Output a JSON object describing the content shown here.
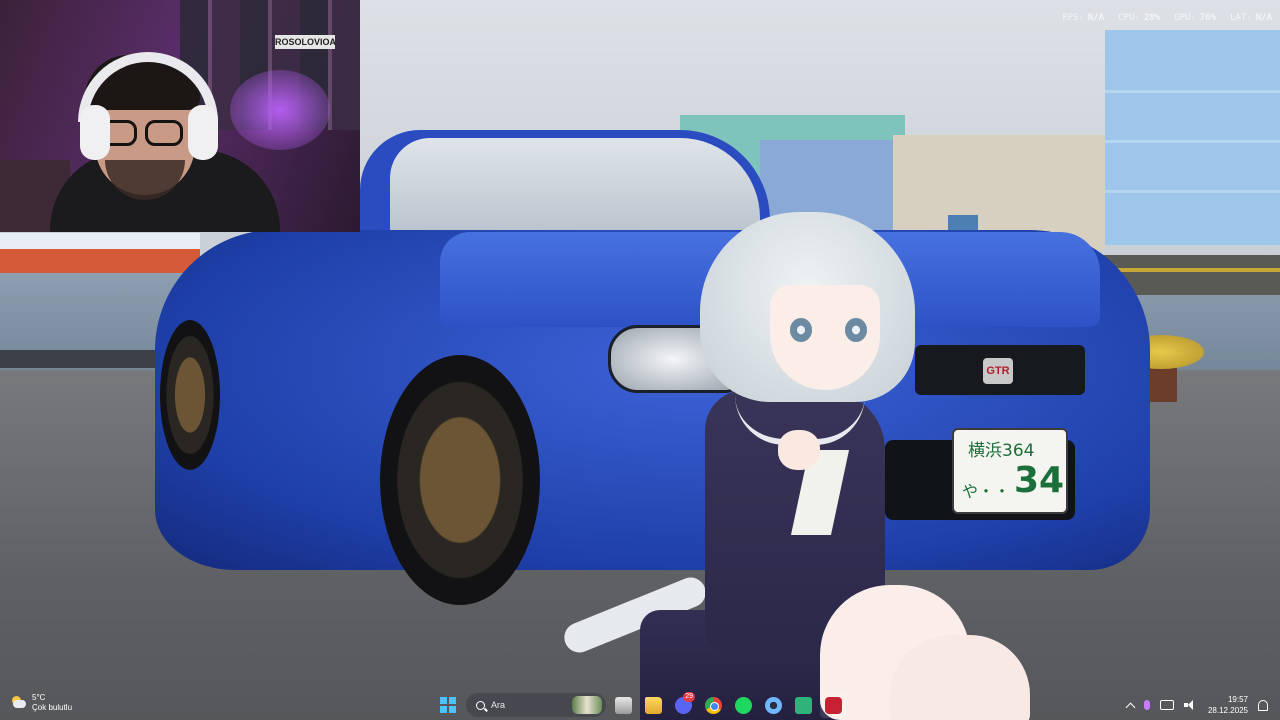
{
  "webcam": {
    "poster_text": "ROSOLOVIOA"
  },
  "plate": {
    "top": "横浜364",
    "left": "や・・",
    "number": "34"
  },
  "emblem": "GTR",
  "stats": [
    {
      "key": "FPS:",
      "value": "N/A"
    },
    {
      "key": "CPU:",
      "value": "28%"
    },
    {
      "key": "GPU:",
      "value": "76%"
    },
    {
      "key": "LAT:",
      "value": "N/A"
    }
  ],
  "weather": {
    "temp": "5°C",
    "desc": "Çok bulutlu",
    "icon": "partly-cloudy-icon"
  },
  "taskbar": {
    "search_placeholder": "Ara",
    "discord_badge": "29",
    "apps": [
      {
        "name": "task-view-icon"
      },
      {
        "name": "file-explorer-icon"
      },
      {
        "name": "discord-icon"
      },
      {
        "name": "chrome-icon"
      },
      {
        "name": "spotify-icon"
      },
      {
        "name": "settings-gear-icon"
      },
      {
        "name": "app-cube-icon"
      },
      {
        "name": "red-app-icon"
      }
    ]
  },
  "clock": {
    "time": "19:57",
    "date": "28.12.2025"
  }
}
